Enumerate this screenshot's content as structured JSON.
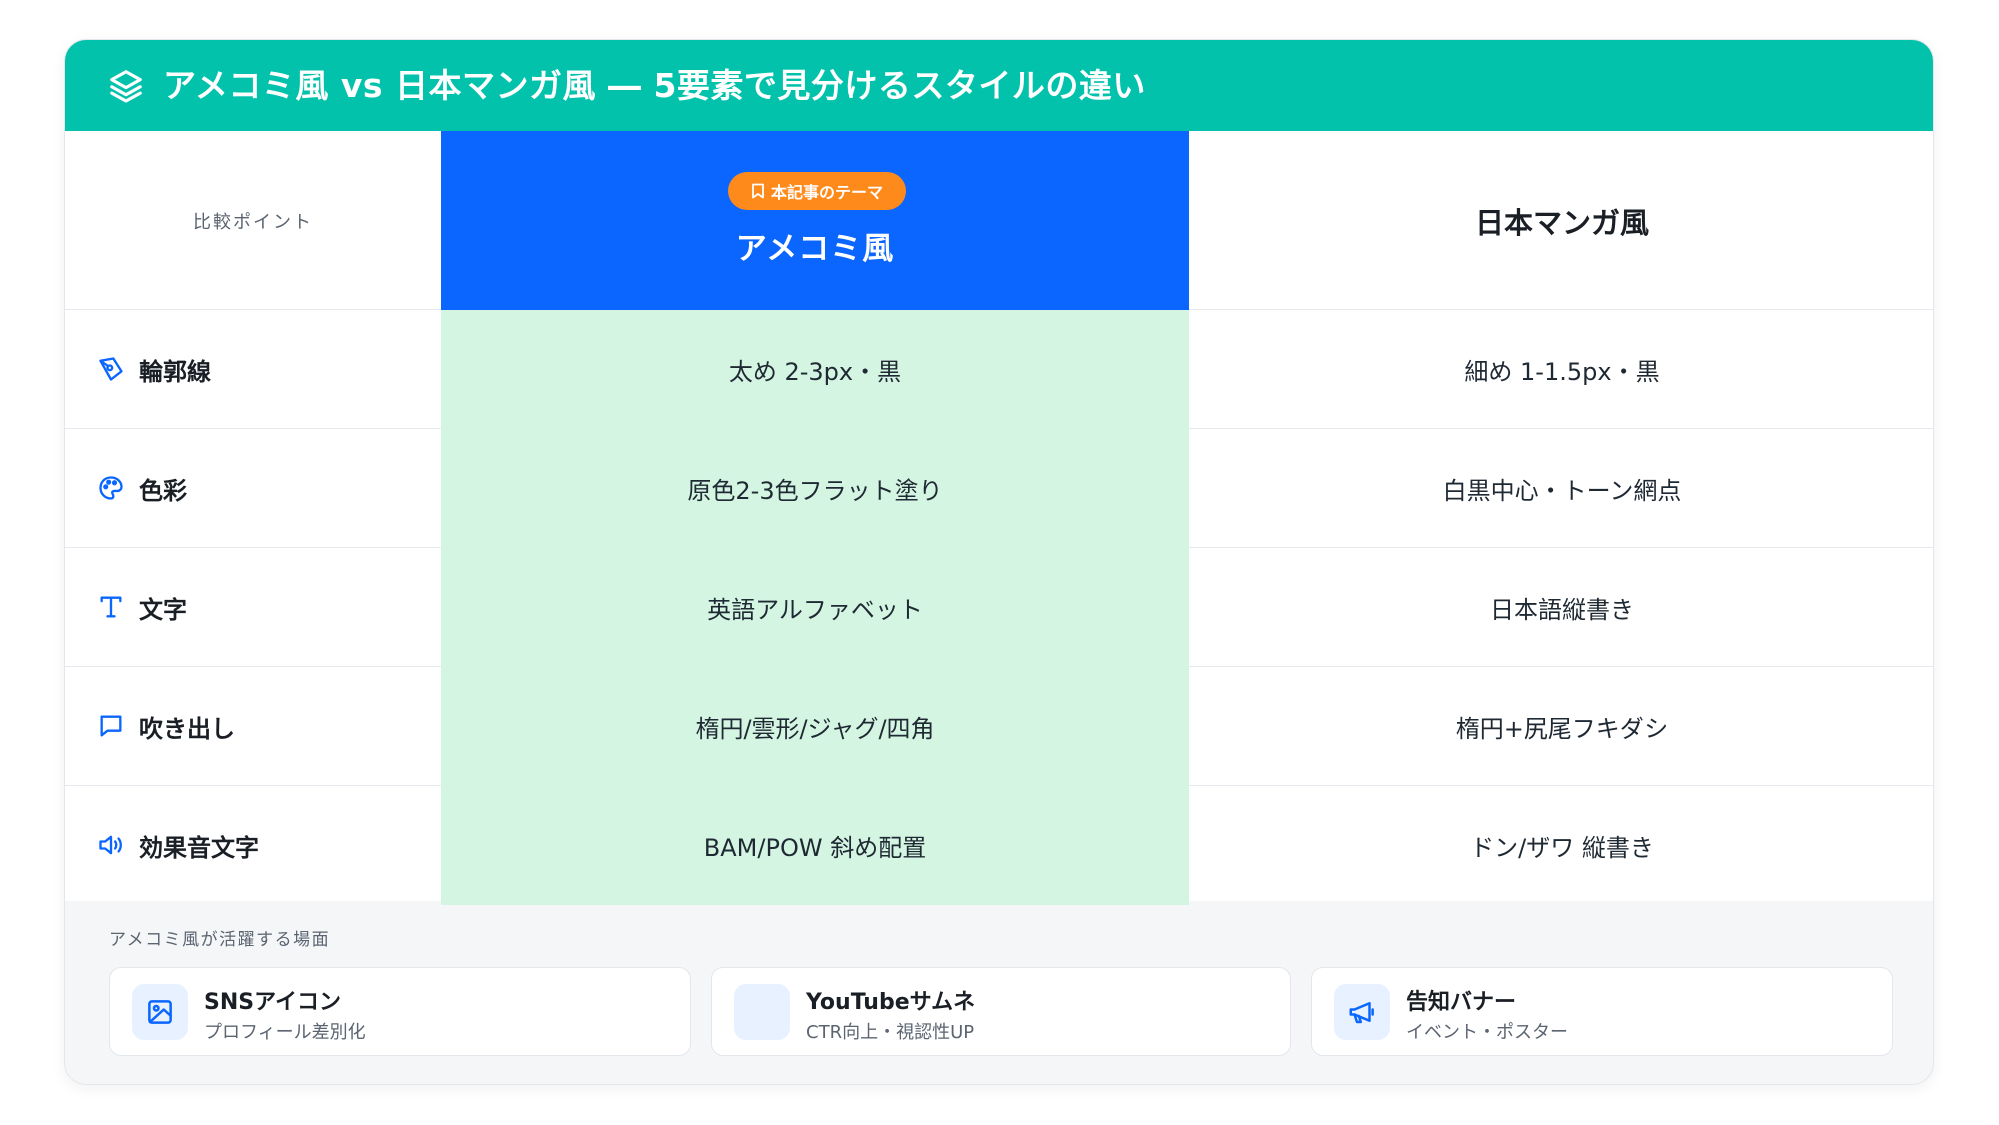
{
  "header": {
    "title": "アメコミ風 vs 日本マンガ風 ― 5要素で見分けるスタイルの違い",
    "icon": "layers-icon"
  },
  "table": {
    "head": {
      "label": "比較ポイント",
      "col_a_badge": "本記事のテーマ",
      "col_a_title": "アメコミ風",
      "col_b_title": "日本マンガ風"
    },
    "rows": [
      {
        "icon": "pen-tool-icon",
        "label": "輪郭線",
        "a": "太め 2-3px・黒",
        "b": "細め 1-1.5px・黒"
      },
      {
        "icon": "palette-icon",
        "label": "色彩",
        "a": "原色2-3色フラット塗り",
        "b": "白黒中心・トーン網点"
      },
      {
        "icon": "type-icon",
        "label": "文字",
        "a": "英語アルファベット",
        "b": "日本語縦書き"
      },
      {
        "icon": "speech-bubble-icon",
        "label": "吹き出し",
        "a": "楕円/雲形/ジャグ/四角",
        "b": "楕円+尻尾フキダシ"
      },
      {
        "icon": "speaker-icon",
        "label": "効果音文字",
        "a": "BAM/POW 斜め配置",
        "b": "ドン/ザワ 縦書き"
      }
    ]
  },
  "uses": {
    "title": "アメコミ風が活躍する場面",
    "items": [
      {
        "icon": "image-icon",
        "name": "SNSアイコン",
        "desc": "プロフィール差別化"
      },
      {
        "icon": "blank-icon",
        "name": "YouTubeサムネ",
        "desc": "CTR向上・視認性UP"
      },
      {
        "icon": "megaphone-icon",
        "name": "告知バナー",
        "desc": "イベント・ポスター"
      }
    ]
  },
  "colors": {
    "header_bg": "#03c2ac",
    "col_a_head_bg": "#0a66ff",
    "col_a_cell_bg": "#d5f5e3",
    "badge_bg": "#ff8a1c",
    "icon_blue": "#0a66ff"
  }
}
